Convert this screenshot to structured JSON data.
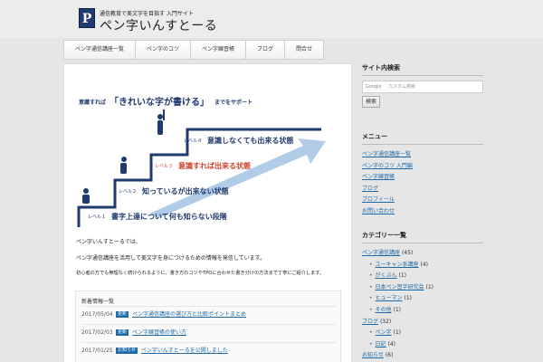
{
  "site": {
    "tagline": "通信教育で美文字を目指す 入門サイト",
    "title": "ペン字いんすとーる",
    "logo_letter": "P"
  },
  "nav": {
    "items": [
      "ペン字通信講座一覧",
      "ペン字のコツ",
      "ペン字練習帳",
      "ブログ",
      "問合せ"
    ]
  },
  "hero": {
    "banner_prefix": "意識すれば",
    "banner_highlight": "「きれいな字が書ける」",
    "banner_suffix": "までをサポート",
    "levels": [
      {
        "label": "レベル１",
        "text": "書字上達について何も知らない段階"
      },
      {
        "label": "レベル２",
        "text": "知っているが出来ない状態"
      },
      {
        "label": "レベル３",
        "text": "意識すれば出来る状態"
      },
      {
        "label": "レベル４",
        "text": "意識しなくても出来る状態"
      }
    ]
  },
  "intro": {
    "line1": "ペン字いんすとーるでは、",
    "line2": "ペン字通信講座を活用して美文字を身につけるための情報を発信しています。",
    "line3": "初心者の方でも無理なく続けられるように、書き方のコツやTPOに合わせた書き分けの方法まで丁寧にご紹介します。"
  },
  "news": {
    "title": "新着情報一覧",
    "items": [
      {
        "date": "2017/05/04",
        "category": "更新",
        "title": "ペン字通信講座の選び方と比較ポイントまとめ"
      },
      {
        "date": "2017/02/03",
        "category": "更新",
        "title": "ペン字練習帳の使い方"
      },
      {
        "date": "2017/01/25",
        "category": "お知らせ",
        "title": "ペン字いんすとーるを公開しました"
      }
    ]
  },
  "sidebar": {
    "search": {
      "title": "サイト内検索",
      "placeholder": "カスタム検索",
      "engine": "Google",
      "button": "検索"
    },
    "links": {
      "title": "メニュー",
      "items": [
        "ペン字通信講座一覧",
        "ペン字のコツ 入門編",
        "ペン字練習帳",
        "ブログ",
        "プロフィール",
        "お問い合わせ"
      ]
    },
    "categories": {
      "title": "カテゴリー一覧",
      "items": [
        {
          "name": "ペン字通信講座",
          "count": "(45)",
          "child": false
        },
        {
          "name": "ユーキャン系講座",
          "count": "(4)",
          "child": true
        },
        {
          "name": "がくぶん",
          "count": "(1)",
          "child": true
        },
        {
          "name": "日本ペン習字研究会",
          "count": "(1)",
          "child": true
        },
        {
          "name": "ヒューマン",
          "count": "(1)",
          "child": true
        },
        {
          "name": "その他",
          "count": "(1)",
          "child": true
        },
        {
          "name": "ブログ",
          "count": "(32)",
          "child": false
        },
        {
          "name": "ペン字",
          "count": "(1)",
          "child": true
        },
        {
          "name": "日記",
          "count": "(4)",
          "child": true
        },
        {
          "name": "お知らせ",
          "count": "(6)",
          "child": false
        }
      ]
    }
  },
  "colors": {
    "accent": "#1e6aa8",
    "hero_navy": "#1f3a6e",
    "hero_red": "#d2412a"
  }
}
